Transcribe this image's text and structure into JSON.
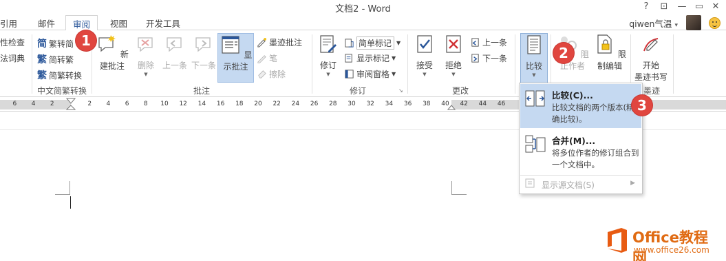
{
  "window": {
    "title": "文档2 - Word",
    "help": "?",
    "restore_ribbon": "⊡",
    "minimize": "—",
    "maximize": "▭",
    "close": "✕"
  },
  "tabs": [
    {
      "label": "引用"
    },
    {
      "label": "邮件"
    },
    {
      "label": "审阅",
      "active": true
    },
    {
      "label": "视图"
    },
    {
      "label": "开发工具"
    }
  ],
  "user": {
    "name": "qiwen气温",
    "caret": "▾"
  },
  "ribbon": {
    "proofing": {
      "items": [
        "性检查",
        "法词典"
      ]
    },
    "chinese_conversion": {
      "to_simplified": "繁转简",
      "to_traditional": "简转繁",
      "convert": "简繁转换",
      "label": "中文简繁转换"
    },
    "comments": {
      "new": "新建批注",
      "delete": "删除",
      "previous": "上一条",
      "next": "下一条",
      "show": "显示批注",
      "ink": "墨迹批注",
      "pen": "笔",
      "eraser": "擦除",
      "label": "批注"
    },
    "tracking": {
      "track_changes": "修订",
      "markup_mode": "简单标记",
      "show_markup": "显示标记",
      "reviewing_pane": "审阅窗格",
      "label": "修订"
    },
    "changes": {
      "accept": "接受",
      "reject": "拒绝",
      "previous": "上一条",
      "next": "下一条",
      "label": "更改"
    },
    "compare": {
      "label": "比较"
    },
    "protect": {
      "block_authors": "阻止作者",
      "restrict": "限制编辑"
    },
    "ink": {
      "start": "开始",
      "start2": "墨迹书写",
      "label": "墨迹"
    }
  },
  "ruler": {
    "numbers": [
      "6",
      "4",
      "2",
      "2",
      "4",
      "6",
      "8",
      "10",
      "12",
      "14",
      "16",
      "18",
      "20",
      "22",
      "24",
      "26",
      "28",
      "30",
      "32",
      "34",
      "36",
      "38",
      "40",
      "42",
      "44",
      "46"
    ]
  },
  "dropdown": {
    "compare": {
      "title": "比较(C)...",
      "desc": "比较文档的两个版本(精确比较)。"
    },
    "combine": {
      "title": "合并(M)...",
      "desc": "将多位作者的修订组合到一个文档中。"
    },
    "show_source": "显示源文档(S)"
  },
  "steps": [
    "1",
    "2",
    "3"
  ],
  "watermark": {
    "brand": "Office教程网",
    "url": "www.office26.com"
  },
  "colors": {
    "accent": "#2b579a",
    "highlight": "#c5d9f1",
    "step": "#e0463f",
    "watermark": "#e06b13"
  }
}
